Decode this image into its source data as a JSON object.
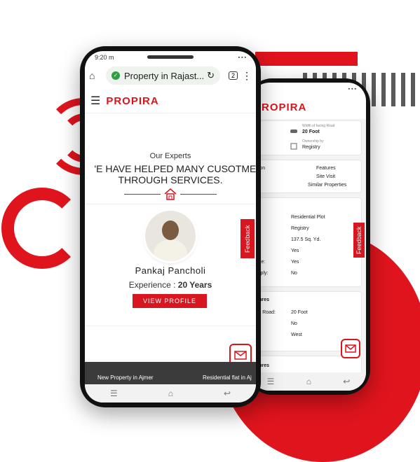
{
  "front": {
    "status_time": "9:20",
    "status_extra": "m",
    "url_text": "Property in Rajast...",
    "tab_count": "2",
    "logo_text": "PROPIRA",
    "section_label": "Our Experts",
    "heading_line1": "'E HAVE HELPED MANY CUSOTMER",
    "heading_line2": "THROUGH SERVICES.",
    "expert_name": "Pankaj Pancholi",
    "experience_label": "Experience :",
    "experience_value": "20 Years",
    "view_profile_label": "VIEW PROFILE",
    "feedback_label": "Feedback",
    "footer_link1": "New Property in Ajmer",
    "footer_link2": "Residential flat in Aj"
  },
  "back": {
    "logo_text": "PROPIRA",
    "road_width_label": "Width of facing Road",
    "road_width_value": "20 Foot",
    "ownership_label": "Ownership by",
    "ownership_value": "Registry",
    "tabs": [
      "ation",
      "Features",
      "on",
      "Site Visit",
      "s",
      "Similar Properties"
    ],
    "details_title": "o",
    "details_rows": [
      {
        "label": "e:",
        "value": "Residential Plot"
      },
      {
        "label": "y:",
        "value": "Registry"
      },
      {
        "label": "",
        "value": "137.5 Sq. Yd."
      },
      {
        "label": "",
        "value": "Yes"
      },
      {
        "label": "able:",
        "value": "Yes"
      },
      {
        "label": "Apply:",
        "value": "No"
      }
    ],
    "features_title": "atures",
    "features_rows": [
      {
        "label": "ing Road:",
        "value": "20 Foot"
      },
      {
        "label": "",
        "value": "No"
      },
      {
        "label": "",
        "value": "West"
      }
    ],
    "bottom_title": "atures",
    "feedback_label": "Feedback"
  },
  "colors": {
    "brand": "#d8161f"
  }
}
